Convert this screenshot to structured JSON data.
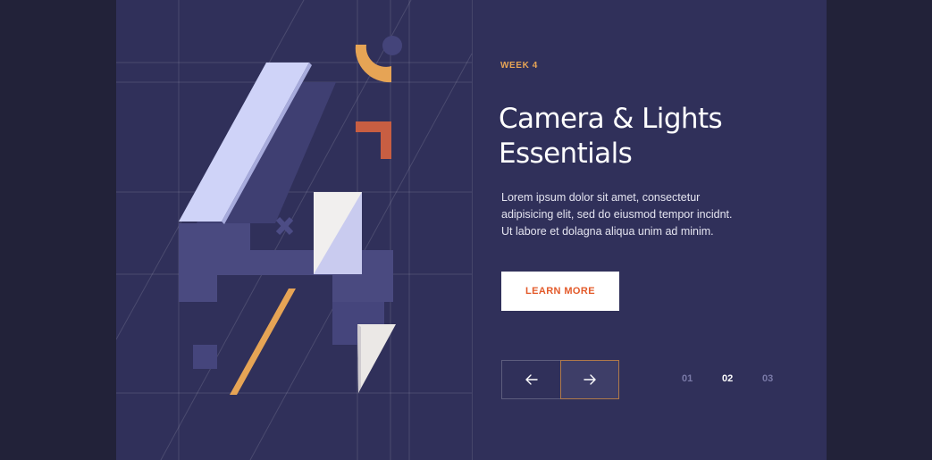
{
  "slide": {
    "eyebrow": "WEEK 4",
    "title_line1": "Camera & Lights",
    "title_line2": "Essentials",
    "description": "Lorem ipsum dolor sit amet, consectetur adipisicing elit, sed do eiusmod tempor incidnt. Ut labore et dolagna aliqua unim ad minim.",
    "cta_label": "LEARN MORE"
  },
  "navigation": {
    "prev_icon": "arrow-left-icon",
    "next_icon": "arrow-right-icon",
    "pages": [
      "01",
      "02",
      "03"
    ],
    "active_page": "02"
  },
  "illustration": {
    "subject": "number-4-geometric-illustration"
  },
  "colors": {
    "page_background": "#222239",
    "card_background": "#30305a",
    "accent_orange": "#e6a455",
    "cta_text": "#e35a2a",
    "shape_lavender": "#ccd0f6",
    "shape_rust": "#c85e42"
  }
}
